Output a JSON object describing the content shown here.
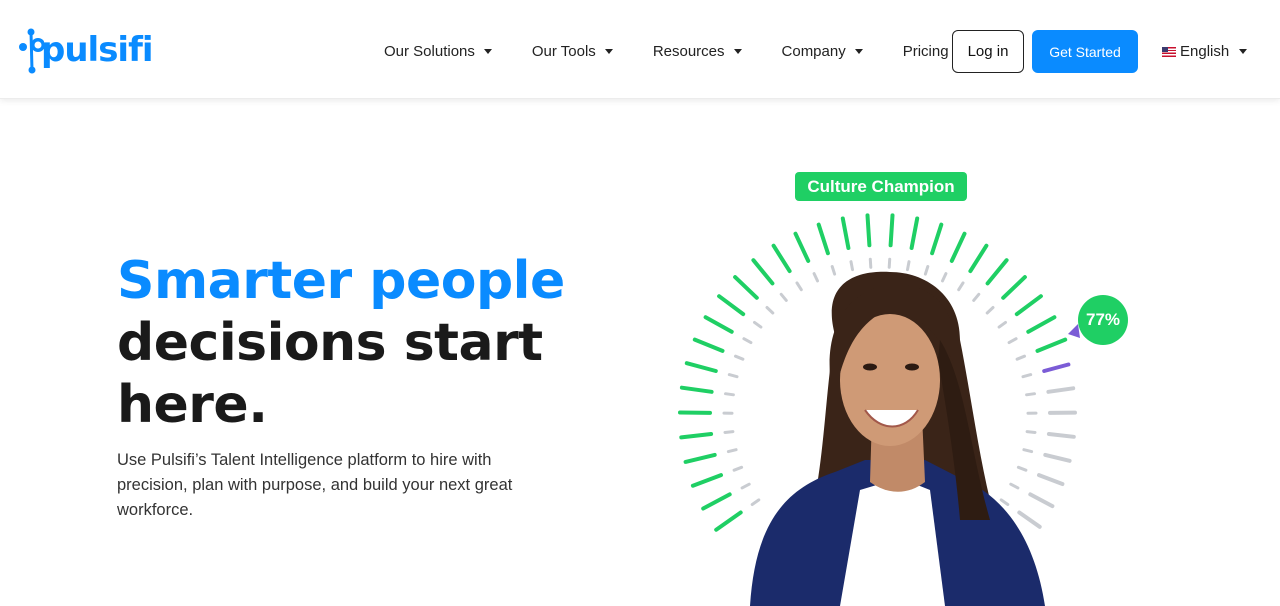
{
  "brand": {
    "name": "pulsifi",
    "color": "#0a8bff"
  },
  "nav": {
    "items": [
      {
        "label": "Our Solutions",
        "has_dropdown": true
      },
      {
        "label": "Our Tools",
        "has_dropdown": true
      },
      {
        "label": "Resources",
        "has_dropdown": true
      },
      {
        "label": "Company",
        "has_dropdown": true
      },
      {
        "label": "Pricing",
        "has_dropdown": false
      }
    ],
    "login_label": "Log in",
    "cta_label": "Get Started",
    "language": {
      "label": "English",
      "icon": "us-flag-icon"
    }
  },
  "hero": {
    "headline_highlight": "Smarter people",
    "headline_line2": "decisions start",
    "headline_line3": "here.",
    "subtext": "Use Pulsifi’s Talent Intelligence platform to hire with precision, plan with purpose, and build your next great workforce."
  },
  "visual": {
    "badge": "Culture Champion",
    "score_label": "77%",
    "score": 0.77,
    "colors": {
      "active": "#1fcf64",
      "inactive": "#c9ccd1",
      "marker": "#7b5cd6"
    }
  }
}
